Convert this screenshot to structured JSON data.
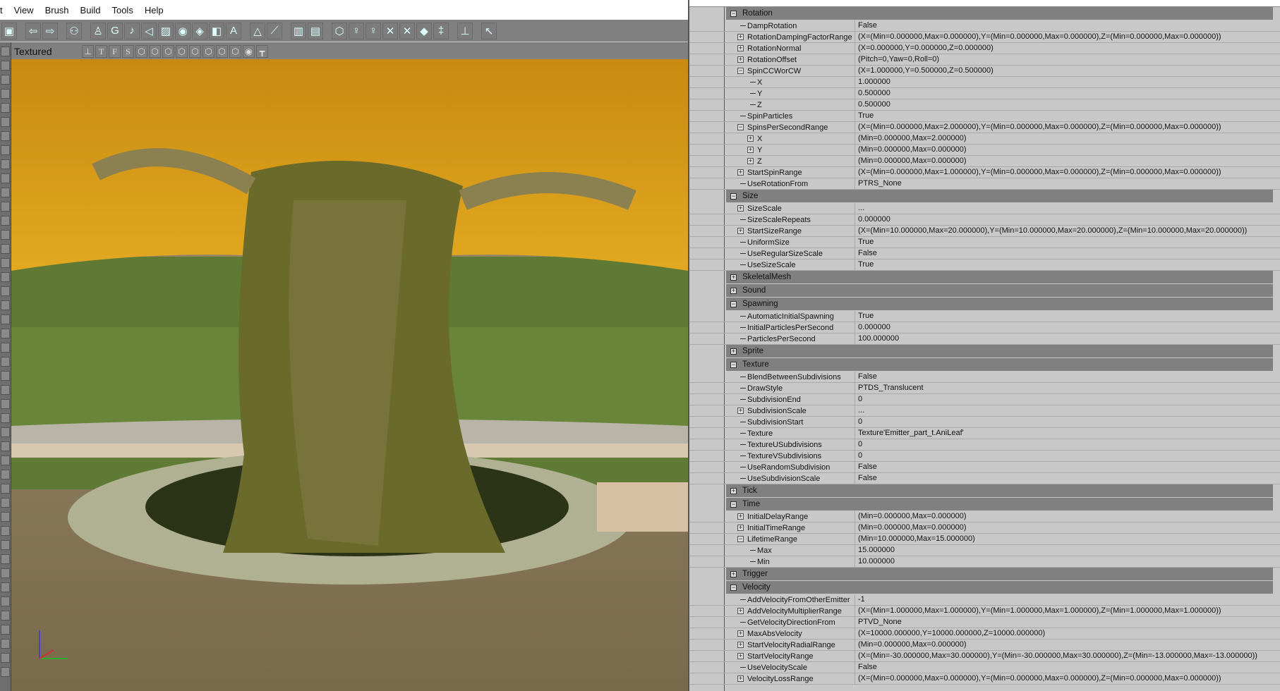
{
  "menu": [
    "t",
    "View",
    "Brush",
    "Build",
    "Tools",
    "Help"
  ],
  "toolbar_icons": [
    "save-icon",
    "|",
    "back-icon",
    "forward-icon",
    "|",
    "binoculars-icon",
    "|",
    "actor-icon",
    "group-icon",
    "music-icon",
    "sound-icon",
    "texture-icon",
    "eye-icon",
    "mesh-icon",
    "static-mesh-icon",
    "font-icon",
    "|",
    "terrain-icon",
    "matinee-icon",
    "|",
    "layer-icon",
    "layer2-icon",
    "|",
    "shield-icon",
    "light-icon",
    "lights-icon",
    "path-icon",
    "path-red-icon",
    "prefab-icon",
    "slider-icon",
    "|",
    "joystick-icon",
    "|",
    "help-cursor-icon"
  ],
  "viewport": {
    "mode_label": "Textured",
    "buttons": [
      "joystick-icon",
      "T",
      "F",
      "S",
      "wire-icon",
      "zone-icon",
      "bsp-icon",
      "lit-icon",
      "unlit-icon",
      "depth-icon",
      "tex-icon",
      "lighting-icon",
      "realtime-eye-icon",
      "lock-icon"
    ]
  },
  "colors": {
    "header": "#808080",
    "panel": "#c8c8c8",
    "canopy": "#d89a10",
    "hedge": "#5a7a30",
    "ground": "#8a7a5a"
  },
  "sections": [
    {
      "title": "Rotation",
      "expanded": true,
      "rows": [
        {
          "name": "DampRotation",
          "value": "False"
        },
        {
          "name": "RotationDampingFactorRange",
          "value": "(X=(Min=0.000000,Max=0.000000),Y=(Min=0.000000,Max=0.000000),Z=(Min=0.000000,Max=0.000000))",
          "ex": "+"
        },
        {
          "name": "RotationNormal",
          "value": "(X=0.000000,Y=0.000000,Z=0.000000)",
          "ex": "+"
        },
        {
          "name": "RotationOffset",
          "value": "(Pitch=0,Yaw=0,Roll=0)",
          "ex": "+"
        },
        {
          "name": "SpinCCWorCW",
          "value": "(X=1.000000,Y=0.500000,Z=0.500000)",
          "ex": "-"
        },
        {
          "name": "X",
          "value": "1.000000",
          "d": 2
        },
        {
          "name": "Y",
          "value": "0.500000",
          "d": 2
        },
        {
          "name": "Z",
          "value": "0.500000",
          "d": 2
        },
        {
          "name": "SpinParticles",
          "value": "True"
        },
        {
          "name": "SpinsPerSecondRange",
          "value": "(X=(Min=0.000000,Max=2.000000),Y=(Min=0.000000,Max=0.000000),Z=(Min=0.000000,Max=0.000000))",
          "ex": "-"
        },
        {
          "name": "X",
          "value": "(Min=0.000000,Max=2.000000)",
          "d": 2,
          "ex": "+"
        },
        {
          "name": "Y",
          "value": "(Min=0.000000,Max=0.000000)",
          "d": 2,
          "ex": "+"
        },
        {
          "name": "Z",
          "value": "(Min=0.000000,Max=0.000000)",
          "d": 2,
          "ex": "+"
        },
        {
          "name": "StartSpinRange",
          "value": "(X=(Min=0.000000,Max=1.000000),Y=(Min=0.000000,Max=0.000000),Z=(Min=0.000000,Max=0.000000))",
          "ex": "+"
        },
        {
          "name": "UseRotationFrom",
          "value": "PTRS_None"
        }
      ]
    },
    {
      "title": "Size",
      "expanded": true,
      "rows": [
        {
          "name": "SizeScale",
          "value": "...",
          "ex": "+"
        },
        {
          "name": "SizeScaleRepeats",
          "value": "0.000000"
        },
        {
          "name": "StartSizeRange",
          "value": "(X=(Min=10.000000,Max=20.000000),Y=(Min=10.000000,Max=20.000000),Z=(Min=10.000000,Max=20.000000))",
          "ex": "+"
        },
        {
          "name": "UniformSize",
          "value": "True"
        },
        {
          "name": "UseRegularSizeScale",
          "value": "False"
        },
        {
          "name": "UseSizeScale",
          "value": "True"
        }
      ]
    },
    {
      "title": "SkeletalMesh",
      "expanded": false,
      "rows": []
    },
    {
      "title": "Sound",
      "expanded": false,
      "rows": []
    },
    {
      "title": "Spawning",
      "expanded": true,
      "rows": [
        {
          "name": "AutomaticInitialSpawning",
          "value": "True"
        },
        {
          "name": "InitialParticlesPerSecond",
          "value": "0.000000"
        },
        {
          "name": "ParticlesPerSecond",
          "value": "100.000000"
        }
      ]
    },
    {
      "title": "Sprite",
      "expanded": false,
      "rows": []
    },
    {
      "title": "Texture",
      "expanded": true,
      "rows": [
        {
          "name": "BlendBetweenSubdivisions",
          "value": "False"
        },
        {
          "name": "DrawStyle",
          "value": "PTDS_Translucent"
        },
        {
          "name": "SubdivisionEnd",
          "value": "0"
        },
        {
          "name": "SubdivisionScale",
          "value": "...",
          "ex": "+"
        },
        {
          "name": "SubdivisionStart",
          "value": "0"
        },
        {
          "name": "Texture",
          "value": "Texture'Emitter_part_t.AniLeaf'"
        },
        {
          "name": "TextureUSubdivisions",
          "value": "0"
        },
        {
          "name": "TextureVSubdivisions",
          "value": "0"
        },
        {
          "name": "UseRandomSubdivision",
          "value": "False"
        },
        {
          "name": "UseSubdivisionScale",
          "value": "False"
        }
      ]
    },
    {
      "title": "Tick",
      "expanded": false,
      "rows": []
    },
    {
      "title": "Time",
      "expanded": true,
      "rows": [
        {
          "name": "InitialDelayRange",
          "value": "(Min=0.000000,Max=0.000000)",
          "ex": "+"
        },
        {
          "name": "InitialTimeRange",
          "value": "(Min=0.000000,Max=0.000000)",
          "ex": "+"
        },
        {
          "name": "LifetimeRange",
          "value": "(Min=10.000000,Max=15.000000)",
          "ex": "-"
        },
        {
          "name": "Max",
          "value": "15.000000",
          "d": 2
        },
        {
          "name": "Min",
          "value": "10.000000",
          "d": 2
        }
      ]
    },
    {
      "title": "Trigger",
      "expanded": false,
      "rows": []
    },
    {
      "title": "Velocity",
      "expanded": true,
      "rows": [
        {
          "name": "AddVelocityFromOtherEmitter",
          "value": "-1"
        },
        {
          "name": "AddVelocityMultiplierRange",
          "value": "(X=(Min=1.000000,Max=1.000000),Y=(Min=1.000000,Max=1.000000),Z=(Min=1.000000,Max=1.000000))",
          "ex": "+"
        },
        {
          "name": "GetVelocityDirectionFrom",
          "value": "PTVD_None"
        },
        {
          "name": "MaxAbsVelocity",
          "value": "(X=10000.000000,Y=10000.000000,Z=10000.000000)",
          "ex": "+"
        },
        {
          "name": "StartVelocityRadialRange",
          "value": "(Min=0.000000,Max=0.000000)",
          "ex": "+"
        },
        {
          "name": "StartVelocityRange",
          "value": "(X=(Min=-30.000000,Max=30.000000),Y=(Min=-30.000000,Max=30.000000),Z=(Min=-13.000000,Max=-13.000000))",
          "ex": "+"
        },
        {
          "name": "UseVelocityScale",
          "value": "False"
        },
        {
          "name": "VelocityLossRange",
          "value": "(X=(Min=0.000000,Max=0.000000),Y=(Min=0.000000,Max=0.000000),Z=(Min=0.000000,Max=0.000000))",
          "ex": "+"
        }
      ]
    }
  ]
}
